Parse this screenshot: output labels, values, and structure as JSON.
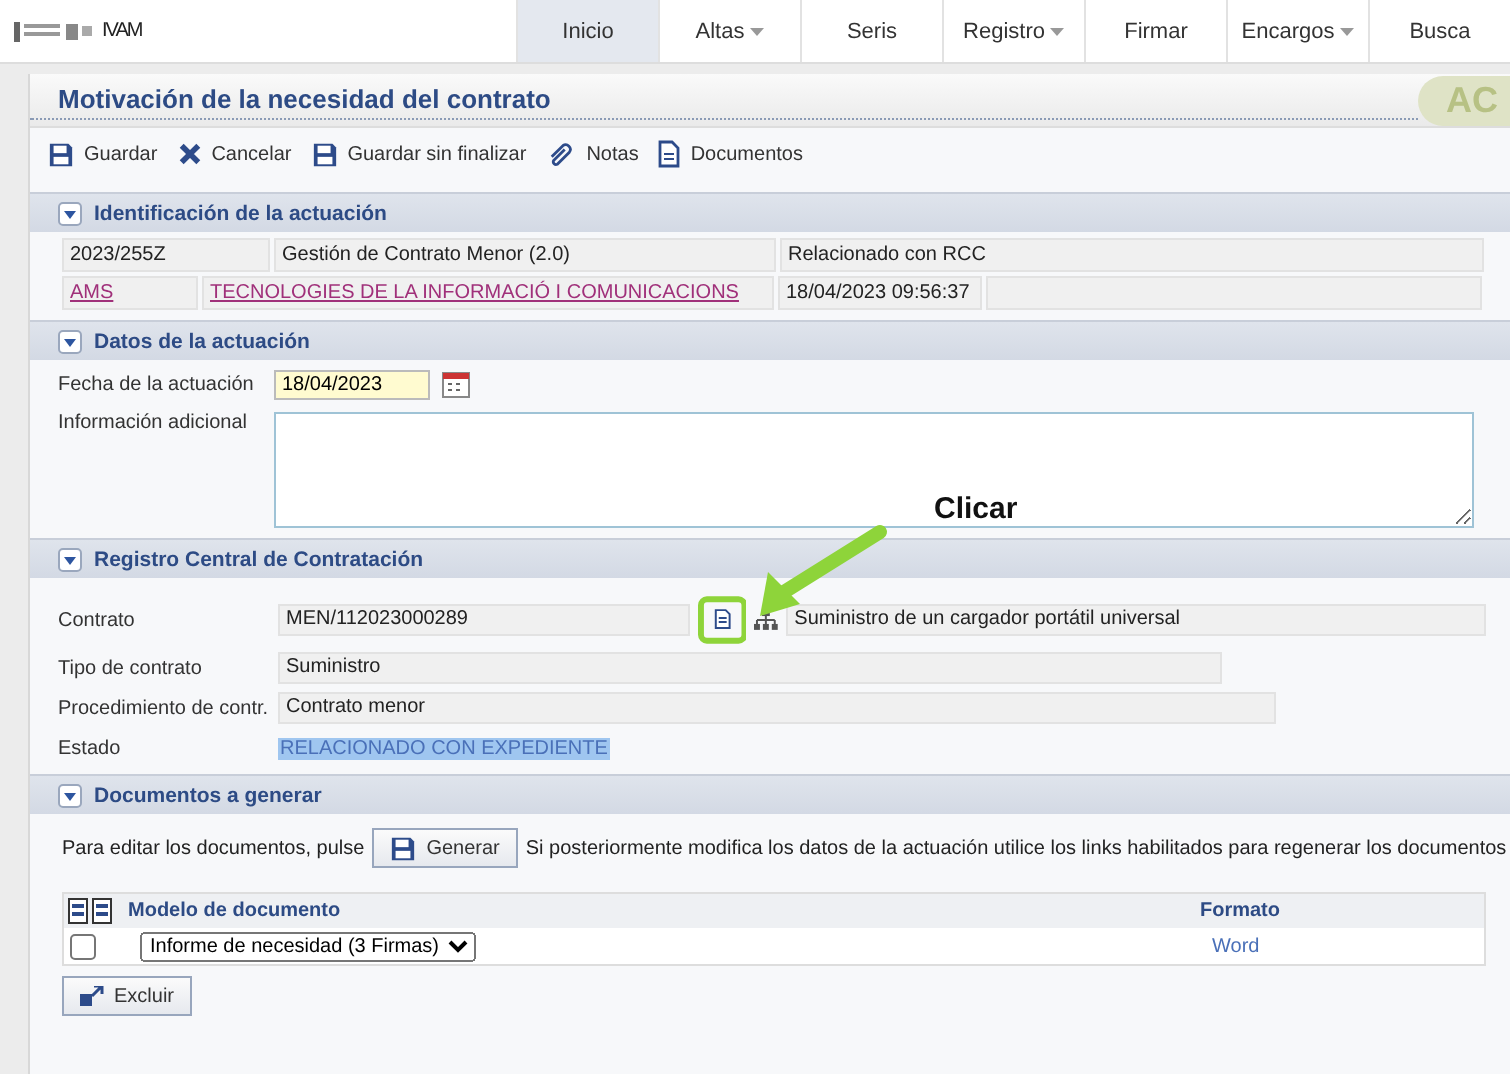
{
  "header": {
    "brand": "IVAM",
    "nav": [
      {
        "label": "Inicio",
        "selected": true,
        "dropdown": false
      },
      {
        "label": "Altas",
        "selected": false,
        "dropdown": true
      },
      {
        "label": "Seris",
        "selected": false,
        "dropdown": false
      },
      {
        "label": "Registro",
        "selected": false,
        "dropdown": true
      },
      {
        "label": "Firmar",
        "selected": false,
        "dropdown": false
      },
      {
        "label": "Encargos",
        "selected": false,
        "dropdown": true
      },
      {
        "label": "Busca",
        "selected": false,
        "dropdown": false
      }
    ]
  },
  "page": {
    "title": "Motivación de la necesidad del contrato",
    "badge": "AC"
  },
  "toolbar": [
    {
      "label": "Guardar",
      "kind": "save"
    },
    {
      "label": "Cancelar",
      "kind": "cancel"
    },
    {
      "label": "Guardar sin finalizar",
      "kind": "save"
    },
    {
      "label": "Notas",
      "kind": "attach"
    },
    {
      "label": "Documentos",
      "kind": "document"
    }
  ],
  "identification": {
    "title": "Identificación de la actuación",
    "expanded": true,
    "rows": [
      [
        {
          "text": "2023/255Z",
          "kind": "text"
        },
        {
          "text": "Gestión de Contrato Menor (2.0)",
          "kind": "text"
        },
        {
          "text": "Relacionado con RCC",
          "kind": "text"
        }
      ],
      [
        {
          "text": "AMS",
          "kind": "link"
        },
        {
          "text": "TECNOLOGIES DE LA INFORMACIÓ I COMUNICACIONS",
          "kind": "link"
        },
        {
          "text": "18/04/2023 09:56:37",
          "kind": "text"
        }
      ]
    ]
  },
  "details": {
    "title": "Datos de la actuación",
    "expanded": true,
    "date_label": "Fecha de la actuación",
    "date_value": "18/04/2023",
    "info_label": "Información adicional"
  },
  "registry": {
    "title": "Registro Central de Contratación",
    "expanded": true,
    "contract_label": "Contrato",
    "contract_value": "MEN/112023000289",
    "contract_description": "Suministro de un cargador portátil universal",
    "fields": [
      {
        "label": "Tipo de contrato",
        "value": "Suministro",
        "kind": "box"
      },
      {
        "label": "Procedimiento de contr.",
        "value": "Contrato menor",
        "kind": "box"
      },
      {
        "label": "Estado",
        "value": "RELACIONADO CON EXPEDIENTE",
        "kind": "highlighted"
      }
    ]
  },
  "documents": {
    "title": "Documentos a generar",
    "expanded": true,
    "intro": "Para editar los documentos, pulse",
    "generate_button": "Generar",
    "note": "Si posteriormente modifica los datos de la actuación utilice los links habilitados para regenerar los documentos",
    "columns": [
      "Modelo de documento",
      "Formato"
    ],
    "rows": [
      {
        "checked": false,
        "model": "Informe de necesidad (3 Firmas)",
        "format": "Word"
      }
    ],
    "exclude_button": "Excluir"
  },
  "annotation": {
    "label": "Clicar"
  }
}
